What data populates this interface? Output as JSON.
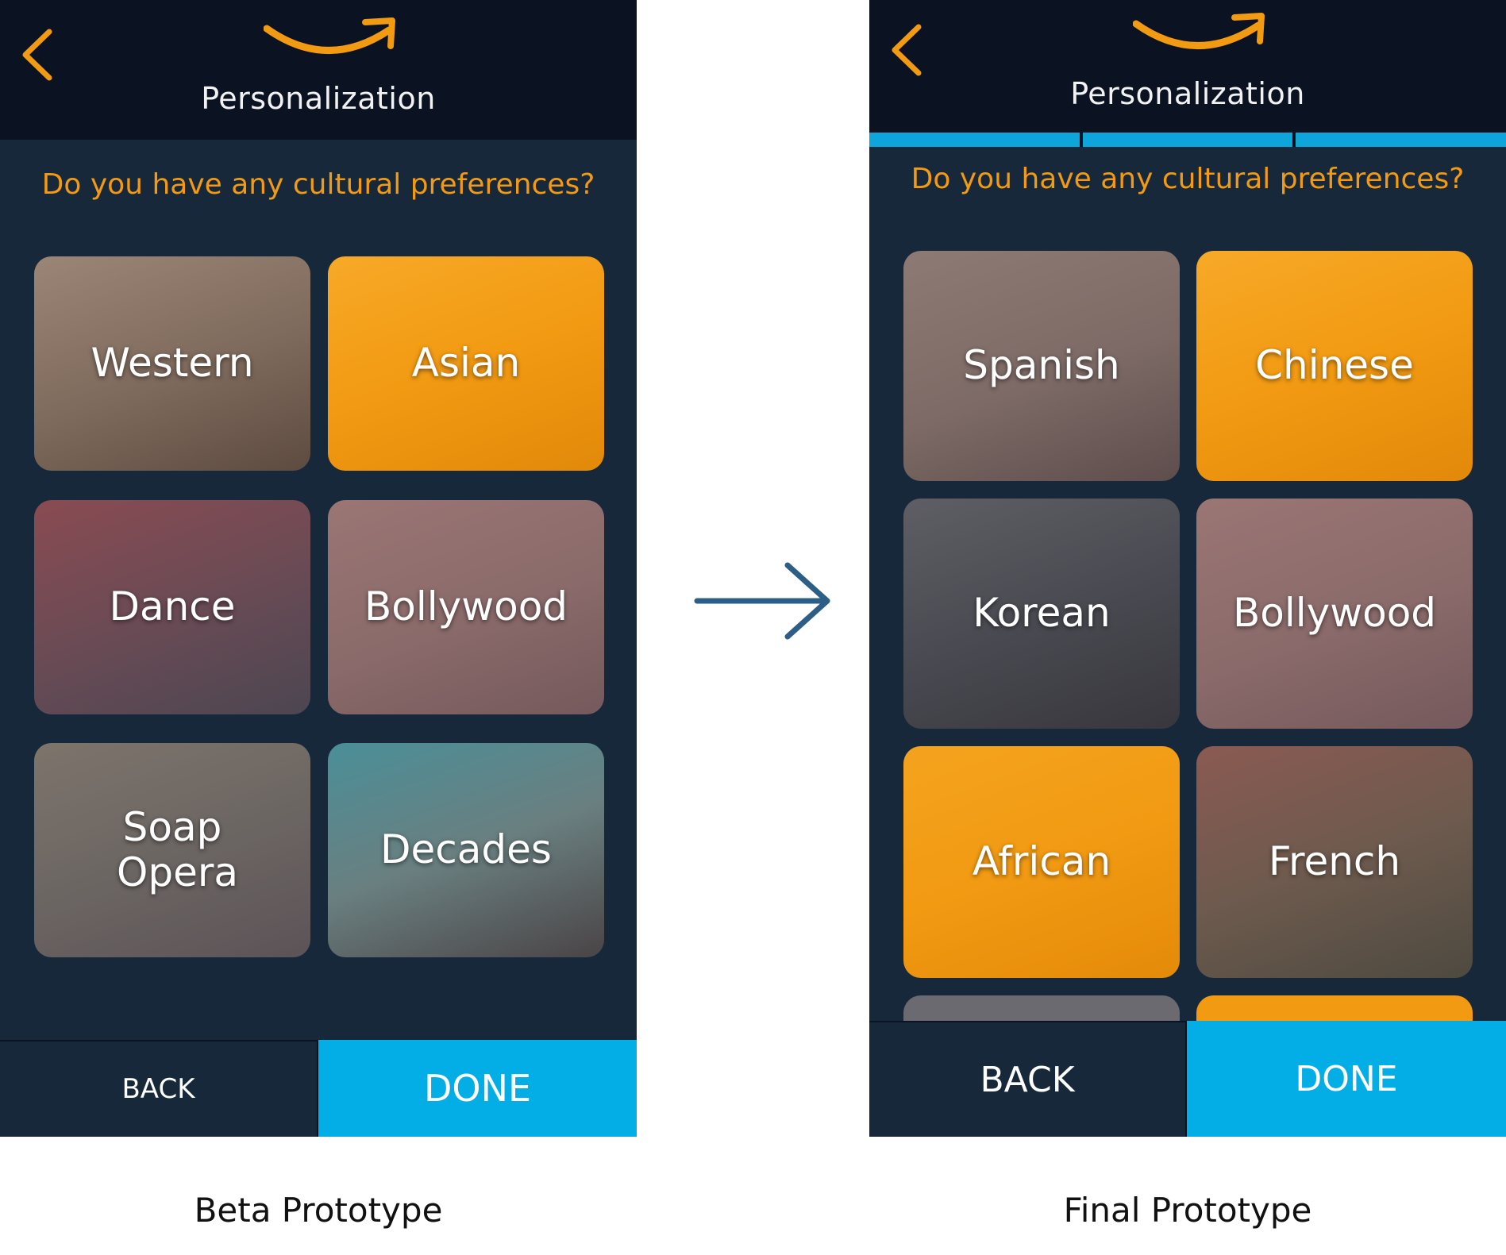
{
  "beta": {
    "title": "Personalization",
    "question": "Do you have any cultural preferences?",
    "tiles": [
      {
        "label": "Western",
        "selected": false,
        "tint": "#8a7466"
      },
      {
        "label": "Asian",
        "selected": true,
        "tint": "#f29a12"
      },
      {
        "label": "Dance",
        "selected": false,
        "tint": "#7a5660"
      },
      {
        "label": "Bollywood",
        "selected": false,
        "tint": "#8a6a6a"
      },
      {
        "label": "Soap Opera",
        "selected": false,
        "tint": "#6c6663"
      },
      {
        "label": "Decades",
        "selected": false,
        "tint": "#5a7d84"
      }
    ],
    "back_label": "BACK",
    "done_label": "DONE",
    "caption": "Beta Prototype"
  },
  "final": {
    "title": "Personalization",
    "progress_segments": 3,
    "question": "Do you have any cultural preferences?",
    "tiles": [
      {
        "label": "Spanish",
        "selected": false,
        "tint": "#7d6a66"
      },
      {
        "label": "Chinese",
        "selected": true,
        "tint": "#f29a12"
      },
      {
        "label": "Korean",
        "selected": false,
        "tint": "#4a4a52"
      },
      {
        "label": "Bollywood",
        "selected": false,
        "tint": "#8a6a6a"
      },
      {
        "label": "African",
        "selected": true,
        "tint": "#f29a12"
      },
      {
        "label": "French",
        "selected": false,
        "tint": "#6e5a4e"
      }
    ],
    "back_label": "BACK",
    "done_label": "DONE",
    "caption": "Final Prototype"
  },
  "colors": {
    "accent_orange": "#f29a12",
    "done_blue": "#03aee6",
    "background_navy": "#17283a",
    "header_navy": "#0b1222",
    "arrow_blue": "#2d5f86"
  },
  "icons": [
    "back-chevron-icon",
    "amazon-smile-logo",
    "arrow-right-icon"
  ]
}
